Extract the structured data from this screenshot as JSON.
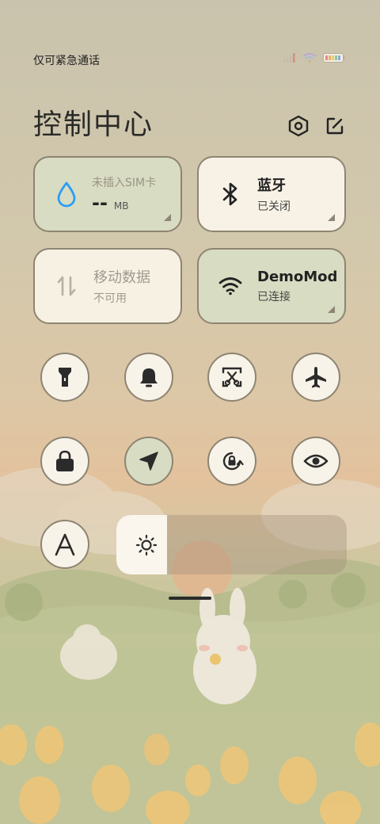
{
  "status": {
    "carrier": "仅可紧急通话"
  },
  "header": {
    "title": "控制中心",
    "settings_icon": "gear-hex-icon",
    "edit_icon": "edit-icon"
  },
  "tiles": {
    "data_usage": {
      "top": "未插入SIM卡",
      "value": "--",
      "unit": "MB",
      "icon": "water-drop-icon"
    },
    "bluetooth": {
      "label": "蓝牙",
      "status": "已关闭",
      "icon": "bluetooth-icon"
    },
    "mobile_data": {
      "label": "移动数据",
      "status": "不可用",
      "icon": "data-arrows-icon"
    },
    "wifi": {
      "label": "DemoMod",
      "status": "已连接",
      "icon": "wifi-icon"
    }
  },
  "toggles": [
    {
      "name": "flashlight",
      "icon": "flashlight-icon",
      "active": false
    },
    {
      "name": "sound",
      "icon": "bell-icon",
      "active": false
    },
    {
      "name": "screenshot",
      "icon": "screenshot-icon",
      "active": false
    },
    {
      "name": "airplane-mode",
      "icon": "airplane-icon",
      "active": false
    },
    {
      "name": "lock-screen",
      "icon": "lock-icon",
      "active": false
    },
    {
      "name": "location",
      "icon": "location-arrow-icon",
      "active": true
    },
    {
      "name": "auto-rotate",
      "icon": "rotate-lock-icon",
      "active": false
    },
    {
      "name": "reading-mode",
      "icon": "eye-icon",
      "active": false
    },
    {
      "name": "font",
      "icon": "font-a-icon",
      "active": false
    }
  ],
  "brightness": {
    "level": 0.22,
    "icon": "sun-icon"
  },
  "colors": {
    "tile_green": "#d8dcc2",
    "tile_cream": "#f8f2e6",
    "border": "#8e8472",
    "wifi_drop_blue": "#2a9df4"
  }
}
